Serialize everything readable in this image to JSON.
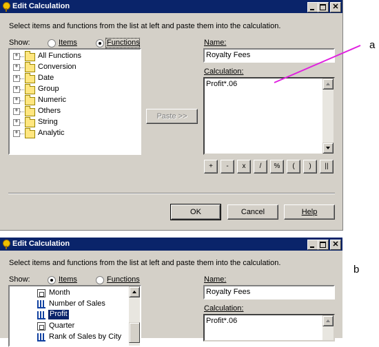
{
  "annotations": {
    "a": "a",
    "b": "b"
  },
  "accent_colors": {
    "titlebar": "#0a246a",
    "pointer_line": "#e020e0",
    "dialog_face": "#d4d0c8"
  },
  "dialog_a": {
    "title": "Edit Calculation",
    "instructions": "Select items and functions from the list at left and paste them into the calculation.",
    "show_label": "Show:",
    "radio_items": "Items",
    "radio_functions": "Functions",
    "selected_radio": "Functions",
    "tree": [
      {
        "label": "All Functions",
        "icon": "folder-icon"
      },
      {
        "label": "Conversion",
        "icon": "folder-icon"
      },
      {
        "label": "Date",
        "icon": "folder-icon"
      },
      {
        "label": "Group",
        "icon": "folder-icon"
      },
      {
        "label": "Numeric",
        "icon": "folder-icon"
      },
      {
        "label": "Others",
        "icon": "folder-icon"
      },
      {
        "label": "String",
        "icon": "folder-icon"
      },
      {
        "label": "Analytic",
        "icon": "folder-icon"
      }
    ],
    "paste_button": "Paste >>",
    "name_label": "Name:",
    "name_value": "Royalty Fees",
    "calculation_label": "Calculation:",
    "calculation_value": "Profit*.06",
    "operators": [
      "+",
      "-",
      "x",
      "/",
      "%",
      "(",
      ")",
      "||"
    ],
    "ok_button": "OK",
    "cancel_button": "Cancel",
    "help_button": "Help"
  },
  "dialog_b": {
    "title": "Edit Calculation",
    "instructions": "Select items and functions from the list at left and paste them into the calculation.",
    "show_label": "Show:",
    "radio_items": "Items",
    "radio_functions": "Functions",
    "selected_radio": "Items",
    "items": [
      {
        "label": "Month",
        "icon": "dimension-icon"
      },
      {
        "label": "Number of Sales",
        "icon": "numeric-item-icon"
      },
      {
        "label": "Profit",
        "icon": "numeric-item-icon",
        "selected": true
      },
      {
        "label": "Quarter",
        "icon": "dimension-icon"
      },
      {
        "label": "Rank of Sales by City",
        "icon": "numeric-item-icon"
      }
    ],
    "name_label": "Name:",
    "name_value": "Royalty Fees",
    "calculation_label": "Calculation:",
    "calculation_value": "Profit*.06"
  }
}
